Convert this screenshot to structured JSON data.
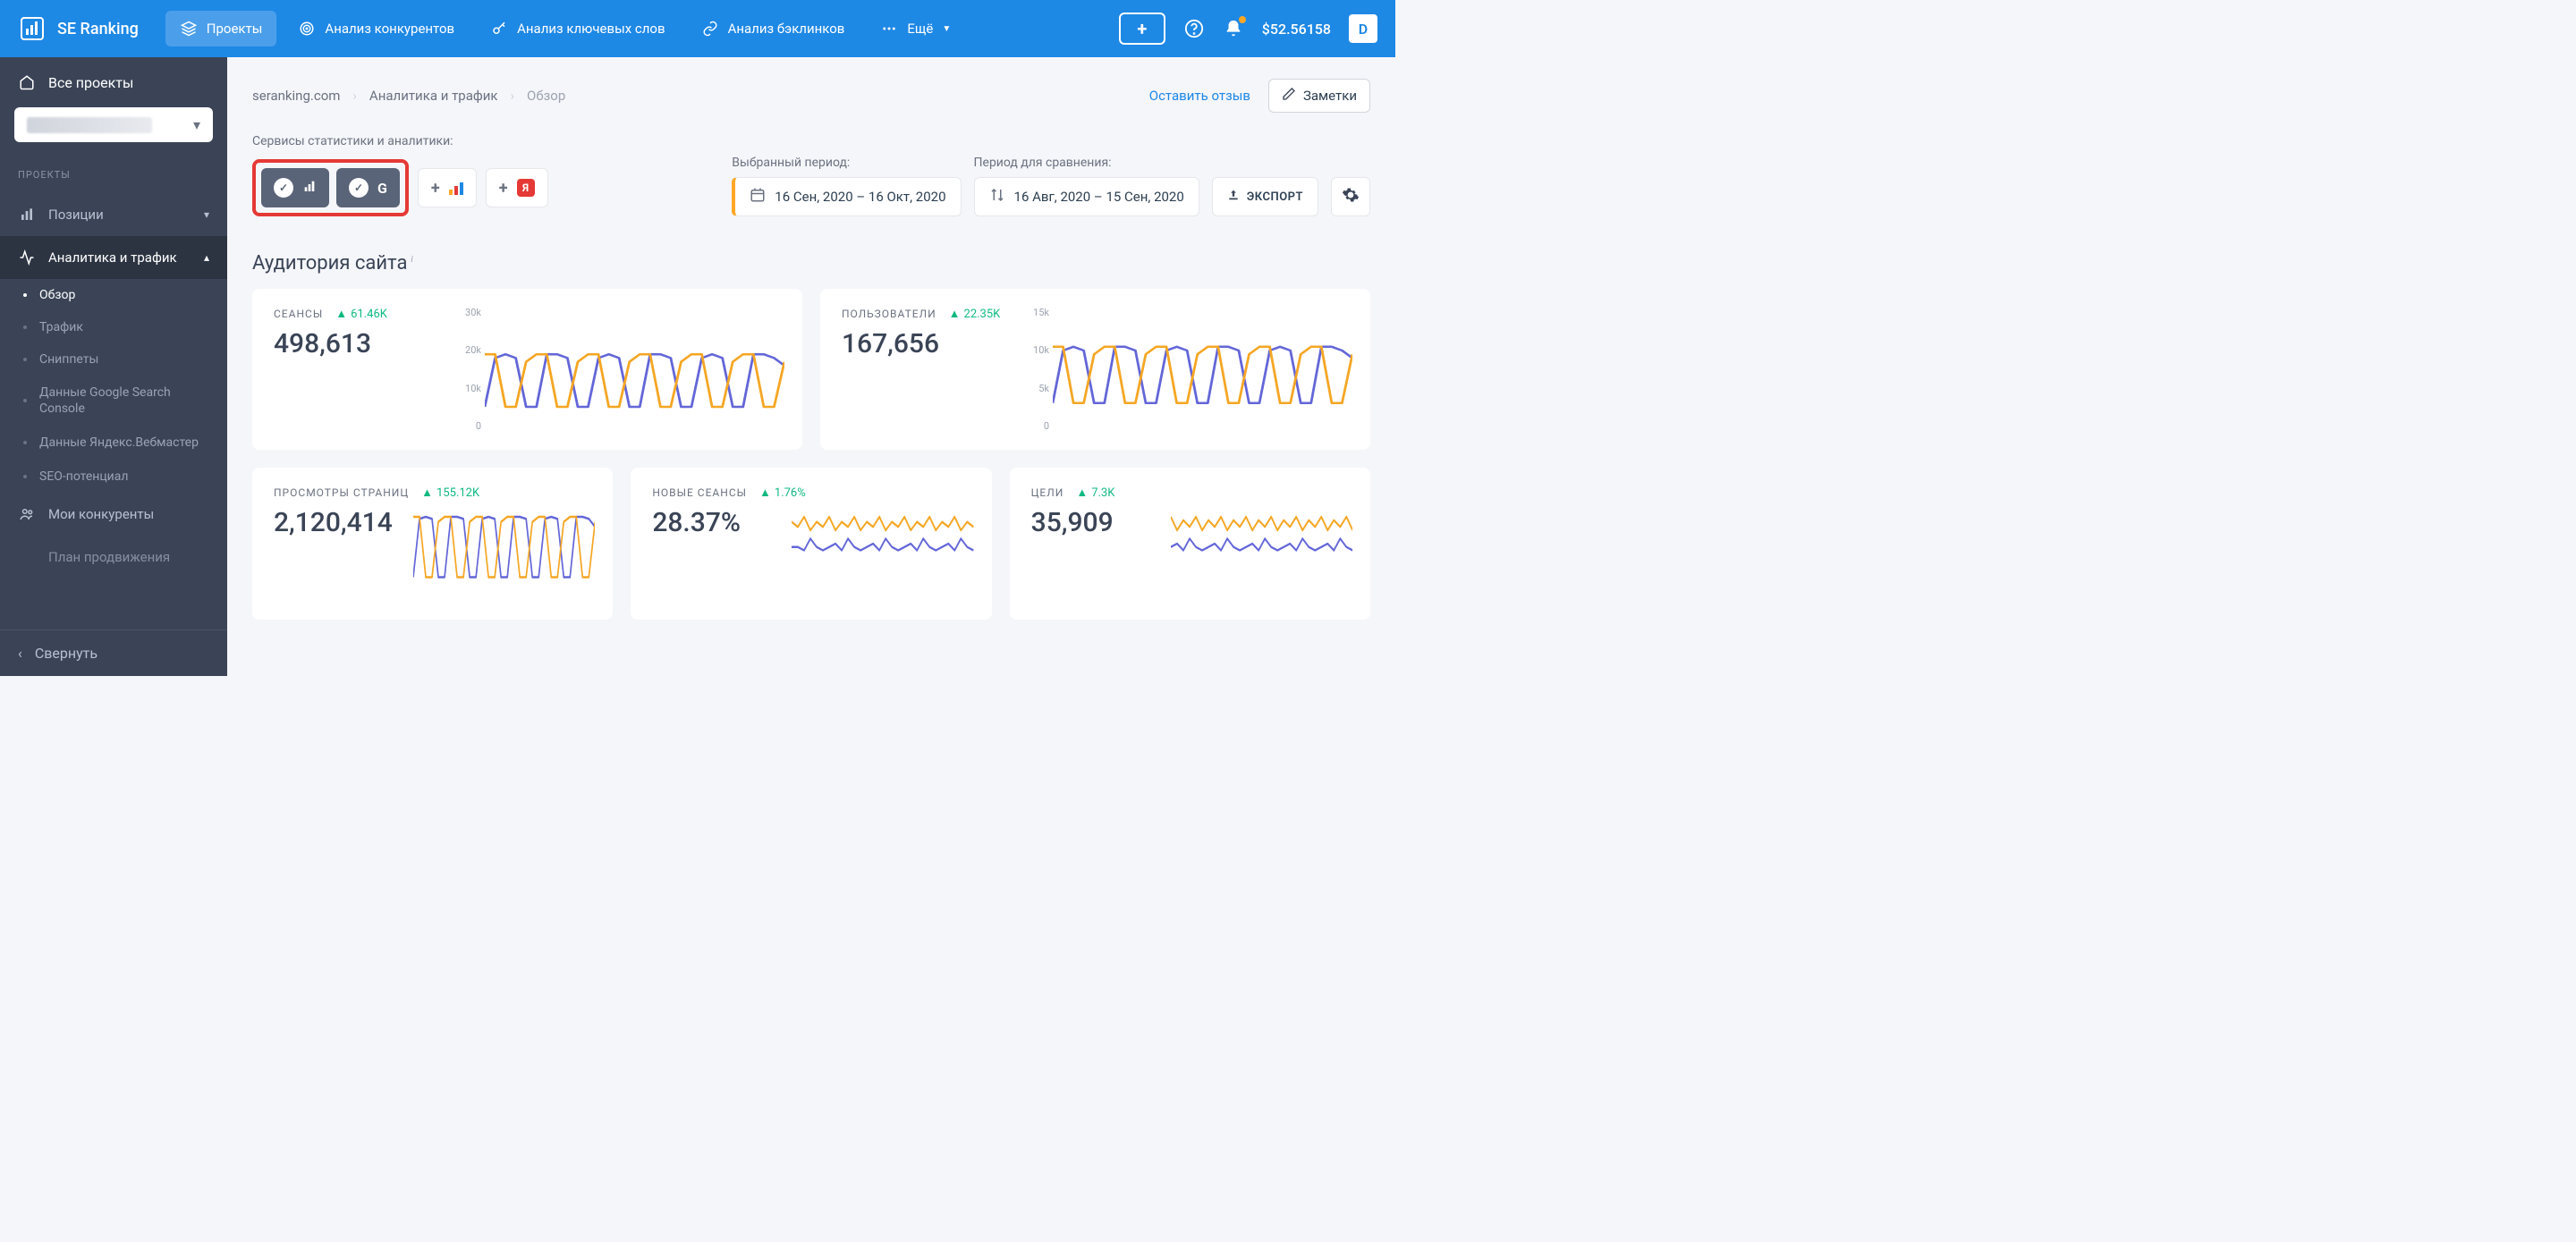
{
  "brand": "SE Ranking",
  "nav": {
    "projects": "Проекты",
    "competitors": "Анализ конкурентов",
    "keywords": "Анализ ключевых слов",
    "backlinks": "Анализ бэклинков",
    "more": "Ещё"
  },
  "topbar": {
    "balance": "$52.56158",
    "avatar": "D"
  },
  "sidebar": {
    "all_projects": "Все проекты",
    "section": "ПРОЕКТЫ",
    "positions": "Позиции",
    "analytics": "Аналитика и трафик",
    "sub": {
      "overview": "Обзор",
      "traffic": "Трафик",
      "snippets": "Сниппеты",
      "gsc": "Данные Google Search Console",
      "yandex": "Данные Яндекс.Вебмастер",
      "seo": "SEO-потенциал"
    },
    "competitors": "Мои конкуренты",
    "plan": "План продвижения",
    "collapse": "Свернуть"
  },
  "breadcrumb": {
    "site": "seranking.com",
    "section": "Аналитика и трафик",
    "page": "Обзор",
    "feedback": "Оставить отзыв",
    "notes": "Заметки"
  },
  "services": {
    "label": "Сервисы статистики и аналитики:"
  },
  "periods": {
    "selected_label": "Выбранный период:",
    "selected": "16 Сен, 2020 – 16 Окт, 2020",
    "compare_label": "Период для сравнения:",
    "compare": "16 Авг, 2020 – 15 Сен, 2020",
    "export": "ЭКСПОРТ"
  },
  "audience": {
    "title": "Аудитория сайта"
  },
  "cards": {
    "sessions": {
      "label": "СЕАНСЫ",
      "delta": "61.46K",
      "value": "498,613",
      "axis": [
        "30k",
        "20k",
        "10k",
        "0"
      ]
    },
    "users": {
      "label": "ПОЛЬЗОВАТЕЛИ",
      "delta": "22.35K",
      "value": "167,656",
      "axis": [
        "15k",
        "10k",
        "5k",
        "0"
      ]
    },
    "pageviews": {
      "label": "ПРОСМОТРЫ СТРАНИЦ",
      "delta": "155.12K",
      "value": "2,120,414"
    },
    "new_sessions": {
      "label": "НОВЫЕ СЕАНСЫ",
      "delta": "1.76%",
      "value": "28.37%"
    },
    "goals": {
      "label": "ЦЕЛИ",
      "delta": "7.3K",
      "value": "35,909"
    }
  },
  "chart_data": [
    {
      "type": "line",
      "title": "Сеансы",
      "ylim": [
        0,
        30000
      ],
      "series": [
        {
          "name": "current",
          "color": "#6366d8",
          "values": [
            5000,
            18000,
            19000,
            18000,
            5000,
            5000,
            19000,
            19000,
            18000,
            5000,
            5000,
            18000,
            19000,
            18000,
            5000,
            5000,
            19000,
            19000,
            18000,
            5000,
            5000,
            18000,
            19000,
            18000,
            5000,
            5000,
            19000,
            19000,
            18000,
            16000
          ]
        },
        {
          "name": "previous",
          "color": "#f5a623",
          "values": [
            19000,
            19000,
            5000,
            5000,
            17000,
            19000,
            19000,
            5000,
            5000,
            17000,
            19000,
            19000,
            5000,
            5000,
            17000,
            19000,
            19000,
            5000,
            5000,
            17000,
            19000,
            19000,
            5000,
            5000,
            17000,
            19000,
            19000,
            5000,
            5000,
            17000
          ]
        }
      ]
    },
    {
      "type": "line",
      "title": "Пользователи",
      "ylim": [
        0,
        15000
      ],
      "series": [
        {
          "name": "current",
          "color": "#6366d8",
          "values": [
            3000,
            10000,
            10500,
            10000,
            3000,
            3000,
            10500,
            10500,
            10000,
            3000,
            3000,
            10000,
            10500,
            10000,
            3000,
            3000,
            10500,
            10500,
            10000,
            3000,
            3000,
            10000,
            10500,
            10000,
            3000,
            3000,
            10500,
            10500,
            10000,
            9000
          ]
        },
        {
          "name": "previous",
          "color": "#f5a623",
          "values": [
            10500,
            10500,
            3000,
            3000,
            9500,
            10500,
            10500,
            3000,
            3000,
            9500,
            10500,
            10500,
            3000,
            3000,
            9500,
            10500,
            10500,
            3000,
            3000,
            9500,
            10500,
            10500,
            3000,
            3000,
            9500,
            10500,
            10500,
            3000,
            3000,
            9500
          ]
        }
      ]
    },
    {
      "type": "line",
      "title": "Просмотры страниц",
      "series": [
        {
          "name": "current",
          "color": "#6366d8",
          "values": [
            20,
            78,
            80,
            78,
            20,
            20,
            80,
            80,
            78,
            20,
            20,
            78,
            80,
            78,
            20,
            20,
            80,
            80,
            78,
            20,
            20,
            78,
            80,
            78,
            20,
            20,
            80,
            80,
            78,
            70
          ]
        },
        {
          "name": "previous",
          "color": "#f5a623",
          "values": [
            80,
            80,
            20,
            20,
            75,
            80,
            80,
            20,
            20,
            75,
            80,
            80,
            20,
            20,
            75,
            80,
            80,
            20,
            20,
            75,
            80,
            80,
            20,
            20,
            75,
            80,
            80,
            20,
            20,
            75
          ]
        }
      ]
    },
    {
      "type": "line",
      "title": "Новые сеансы",
      "series": [
        {
          "name": "current",
          "color": "#6366d8",
          "values": [
            30,
            30,
            28,
            35,
            30,
            28,
            30,
            32,
            28,
            35,
            30,
            28,
            30,
            32,
            28,
            35,
            30,
            28,
            30,
            32,
            28,
            35,
            30,
            28,
            30,
            32,
            28,
            35,
            30,
            28
          ]
        },
        {
          "name": "previous",
          "color": "#f5a623",
          "values": [
            45,
            42,
            48,
            40,
            45,
            42,
            48,
            40,
            45,
            42,
            48,
            40,
            45,
            42,
            48,
            40,
            45,
            42,
            48,
            40,
            45,
            42,
            48,
            40,
            45,
            42,
            48,
            40,
            45,
            42
          ]
        }
      ]
    },
    {
      "type": "line",
      "title": "Цели",
      "series": [
        {
          "name": "current",
          "color": "#6366d8",
          "values": [
            30,
            32,
            28,
            35,
            30,
            28,
            30,
            32,
            28,
            35,
            30,
            28,
            30,
            32,
            28,
            35,
            30,
            28,
            30,
            32,
            28,
            35,
            30,
            28,
            30,
            32,
            28,
            35,
            30,
            28
          ]
        },
        {
          "name": "previous",
          "color": "#f5a623",
          "values": [
            48,
            40,
            46,
            42,
            48,
            40,
            46,
            42,
            48,
            40,
            46,
            42,
            48,
            40,
            46,
            42,
            48,
            40,
            46,
            42,
            48,
            40,
            46,
            42,
            48,
            40,
            46,
            42,
            48,
            40
          ]
        }
      ]
    }
  ]
}
